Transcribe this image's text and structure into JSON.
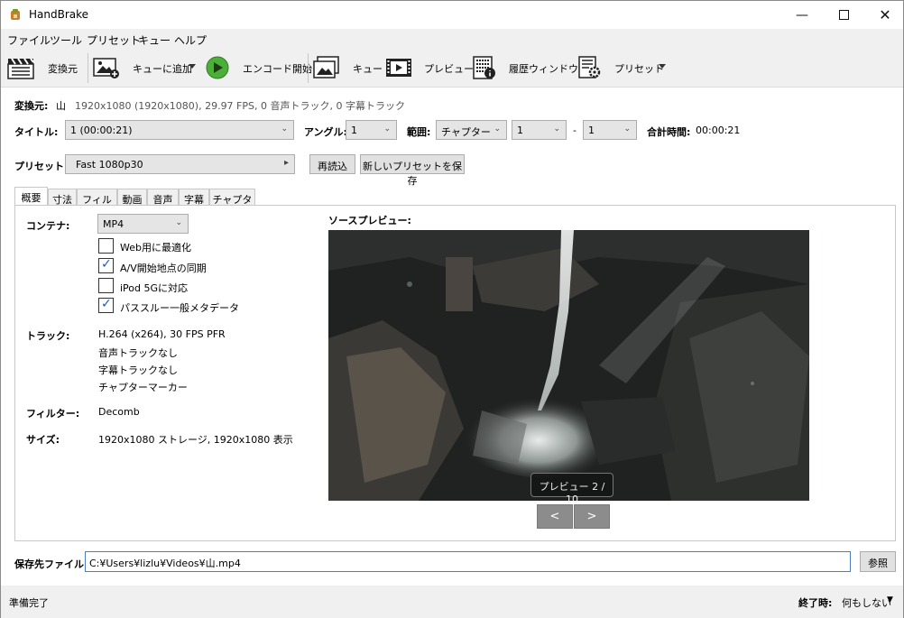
{
  "window": {
    "title": "HandBrake"
  },
  "menu": [
    "ファイル",
    "ツール",
    "プリセット",
    "キュー",
    "ヘルプ"
  ],
  "toolbar": {
    "source": "変換元",
    "add_queue": "キューに追加",
    "start": "エンコード開始",
    "queue": "キュー",
    "preview": "プレビュー",
    "activity": "履歴ウィンドウ",
    "presets": "プリセット"
  },
  "source": {
    "label": "変換元:",
    "name": "山",
    "info": "1920x1080 (1920x1080), 29.97 FPS, 0 音声トラック, 0 字幕トラック"
  },
  "title_row": {
    "title_label": "タイトル:",
    "title_value": "1  (00:00:21)",
    "angle_label": "アングル:",
    "angle_value": "1",
    "range_label": "範囲:",
    "range_type": "チャプター",
    "range_start": "1",
    "range_dash": "-",
    "range_end": "1",
    "duration_label": "合計時間:",
    "duration_value": "00:00:21"
  },
  "preset_row": {
    "label": "プリセット:",
    "value": "Fast 1080p30",
    "reload": "再読込",
    "save_new": "新しいプリセットを保存"
  },
  "tabs": [
    "概要",
    "寸法",
    "フィルタ",
    "動画",
    "音声",
    "字幕",
    "チャプター"
  ],
  "summary": {
    "container_label": "コンテナ:",
    "container_value": "MP4",
    "options": [
      {
        "label": "Web用に最適化",
        "checked": false
      },
      {
        "label": "A/V開始地点の同期",
        "checked": true
      },
      {
        "label": "iPod 5Gに対応",
        "checked": false
      },
      {
        "label": "パススルー一般メタデータ",
        "checked": true
      }
    ],
    "tracks_label": "トラック:",
    "tracks": [
      "H.264 (x264), 30 FPS PFR",
      "音声トラックなし",
      "字幕トラックなし",
      "チャプターマーカー"
    ],
    "filters_label": "フィルター:",
    "filters_value": "Decomb",
    "size_label": "サイズ:",
    "size_value": "1920x1080 ストレージ, 1920x1080 表示"
  },
  "preview": {
    "label": "ソースプレビュー:",
    "badge": "プレビュー 2 / 10",
    "prev": "<",
    "next": ">"
  },
  "destination": {
    "label": "保存先ファイル:",
    "value": "C:¥Users¥lizlu¥Videos¥山.mp4",
    "browse": "参照"
  },
  "status": {
    "text": "準備完了",
    "when_done_label": "終了時:",
    "when_done_value": "何もしない"
  }
}
